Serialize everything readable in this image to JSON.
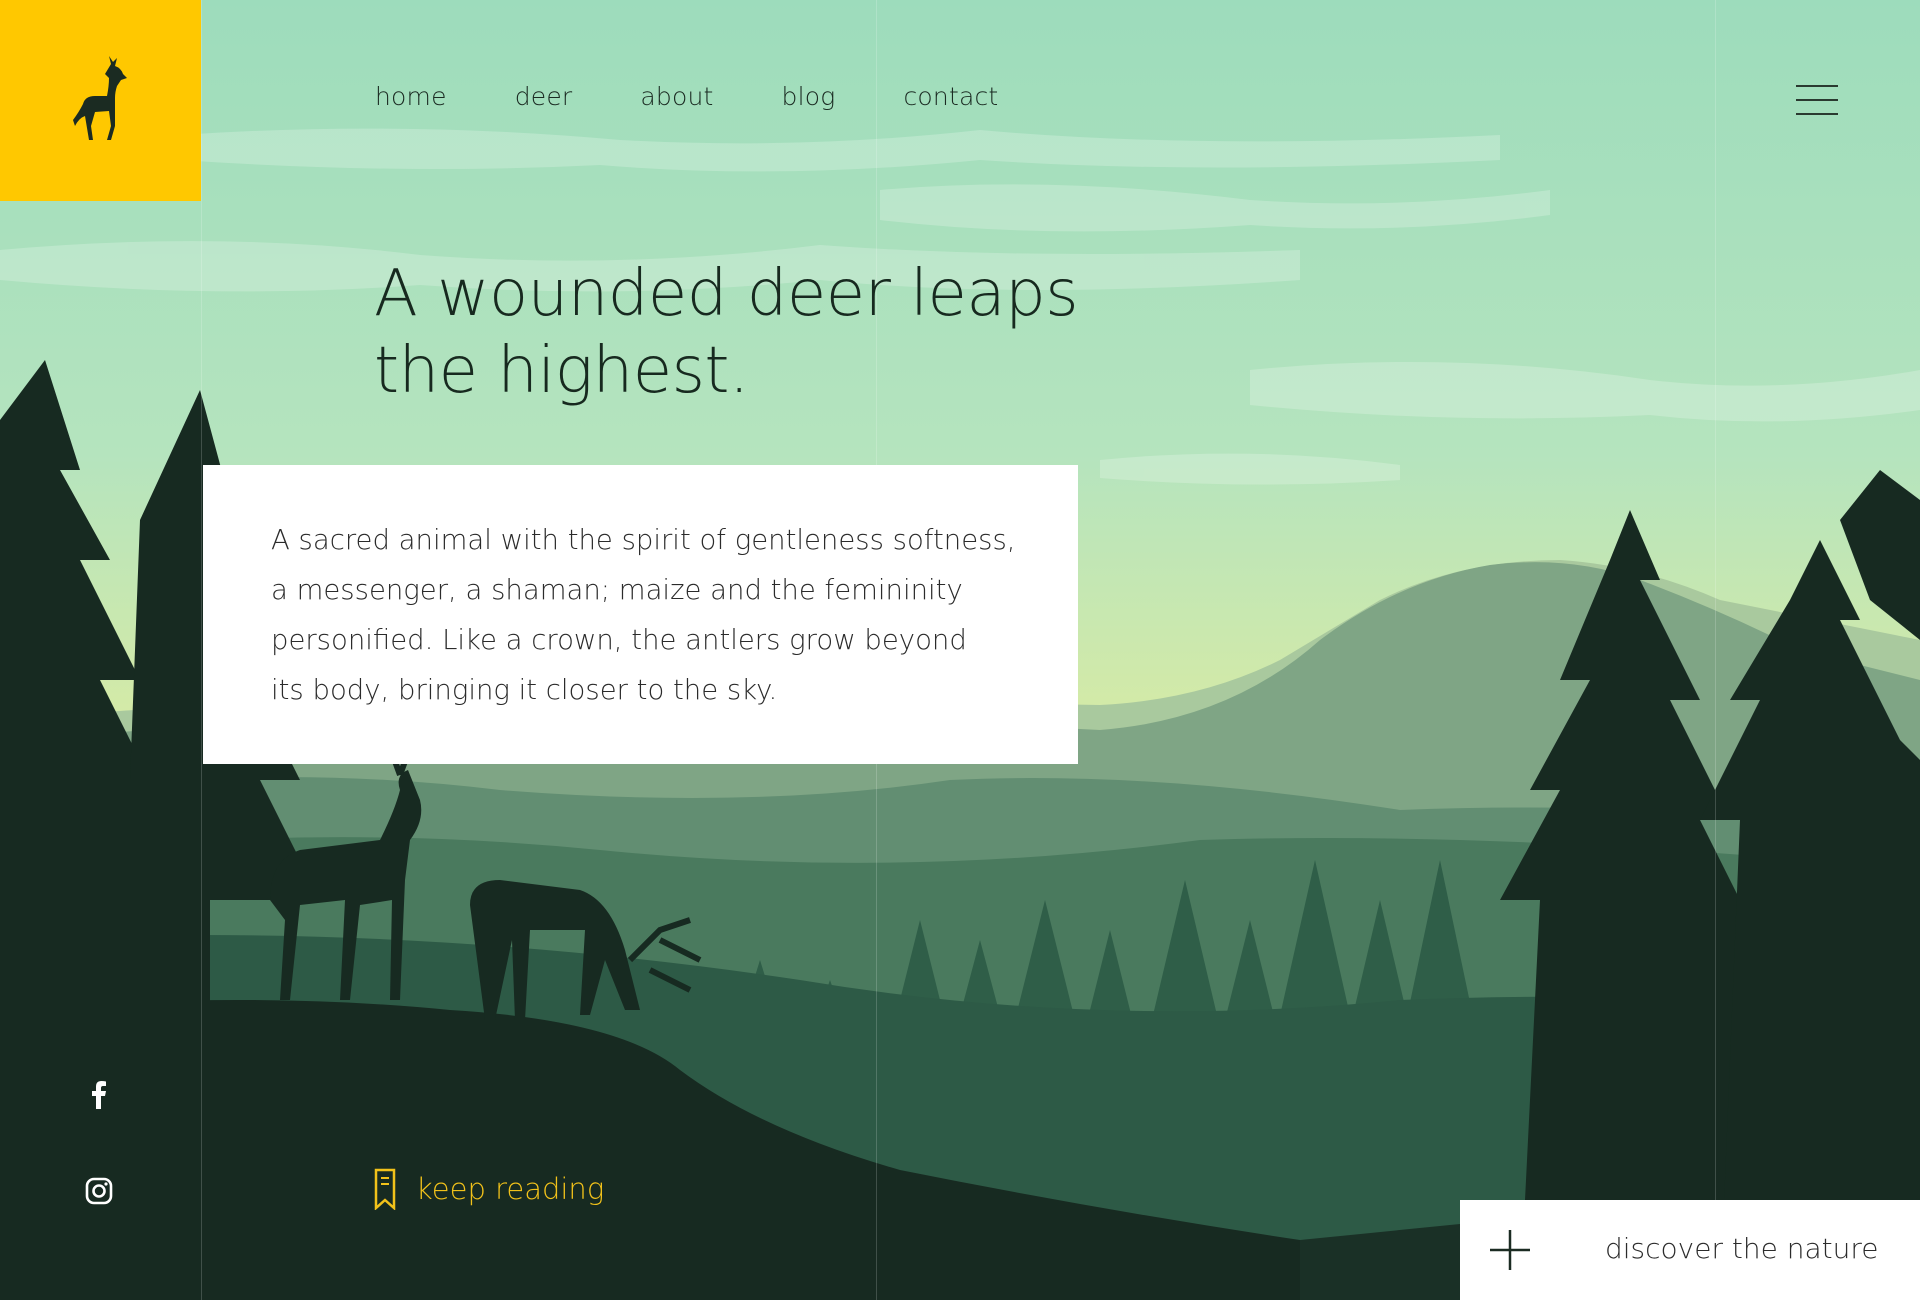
{
  "brand": {
    "logo_icon": "deer-icon",
    "accent": "#ffc800"
  },
  "nav": {
    "items": [
      {
        "label": "home"
      },
      {
        "label": "deer"
      },
      {
        "label": "about"
      },
      {
        "label": "blog"
      },
      {
        "label": "contact"
      }
    ],
    "menu_icon": "hamburger-menu-icon"
  },
  "hero": {
    "headline_line1": "A wounded deer leaps",
    "headline_line2": "the highest.",
    "body_lines": [
      "A sacred animal with the spirit of gentleness softness,",
      "a messenger, a shaman; maize and the femininity",
      "personified. Like a crown, the antlers grow beyond",
      "its body, bringing it closer to the sky."
    ]
  },
  "social": [
    {
      "icon": "facebook-icon"
    },
    {
      "icon": "instagram-icon"
    }
  ],
  "keep_reading": {
    "label": "keep reading",
    "icon": "bookmark-icon",
    "color": "#f2c21a"
  },
  "discover": {
    "label": "discover the nature",
    "icon": "plus-icon"
  },
  "colors": {
    "sky_top": "#9fddbb",
    "sky_bottom": "#d7eaa6",
    "forest_dark": "#172a21",
    "text_dark": "#17291f"
  }
}
